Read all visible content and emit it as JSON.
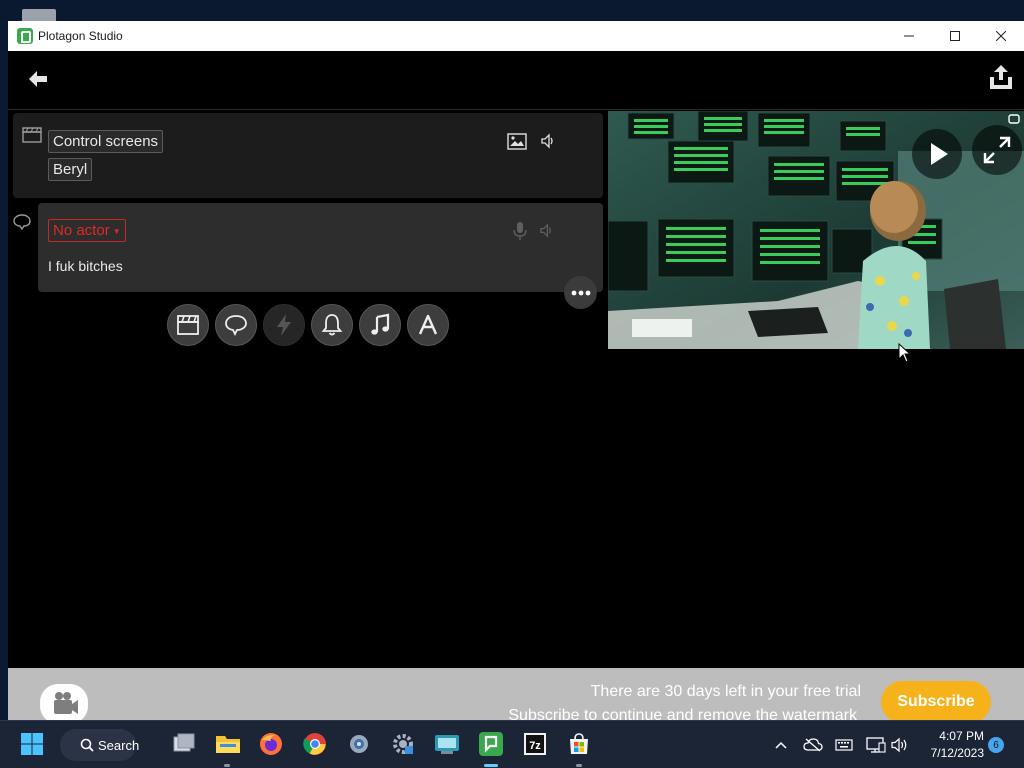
{
  "window": {
    "title": "Plotagon Studio"
  },
  "scene": {
    "location": "Control screens",
    "character": "Beryl"
  },
  "dialogue": {
    "actor": "No actor",
    "text": "I fuk bitches"
  },
  "add_buttons": [
    {
      "name": "add-scene-button",
      "icon": "clapperboard-icon",
      "enabled": true
    },
    {
      "name": "add-dialogue-button",
      "icon": "speech-bubble-icon",
      "enabled": true
    },
    {
      "name": "add-action-button",
      "icon": "lightning-icon",
      "enabled": false
    },
    {
      "name": "add-sound-effect-button",
      "icon": "bell-icon",
      "enabled": true
    },
    {
      "name": "add-music-button",
      "icon": "music-note-icon",
      "enabled": true
    },
    {
      "name": "add-text-button",
      "icon": "text-a-icon",
      "enabled": true
    }
  ],
  "trial": {
    "line1": "There are 30 days left in your free trial",
    "line2": "Subscribe to continue and remove the watermark",
    "subscribe_label": "Subscribe"
  },
  "taskbar": {
    "search_label": "Search",
    "time": "4:07 PM",
    "date": "7/12/2023",
    "notification_count": "6"
  },
  "colors": {
    "accent_subscribe": "#f6b21a",
    "actor_error": "#e02828",
    "plotagon_green": "#3aa84d"
  }
}
